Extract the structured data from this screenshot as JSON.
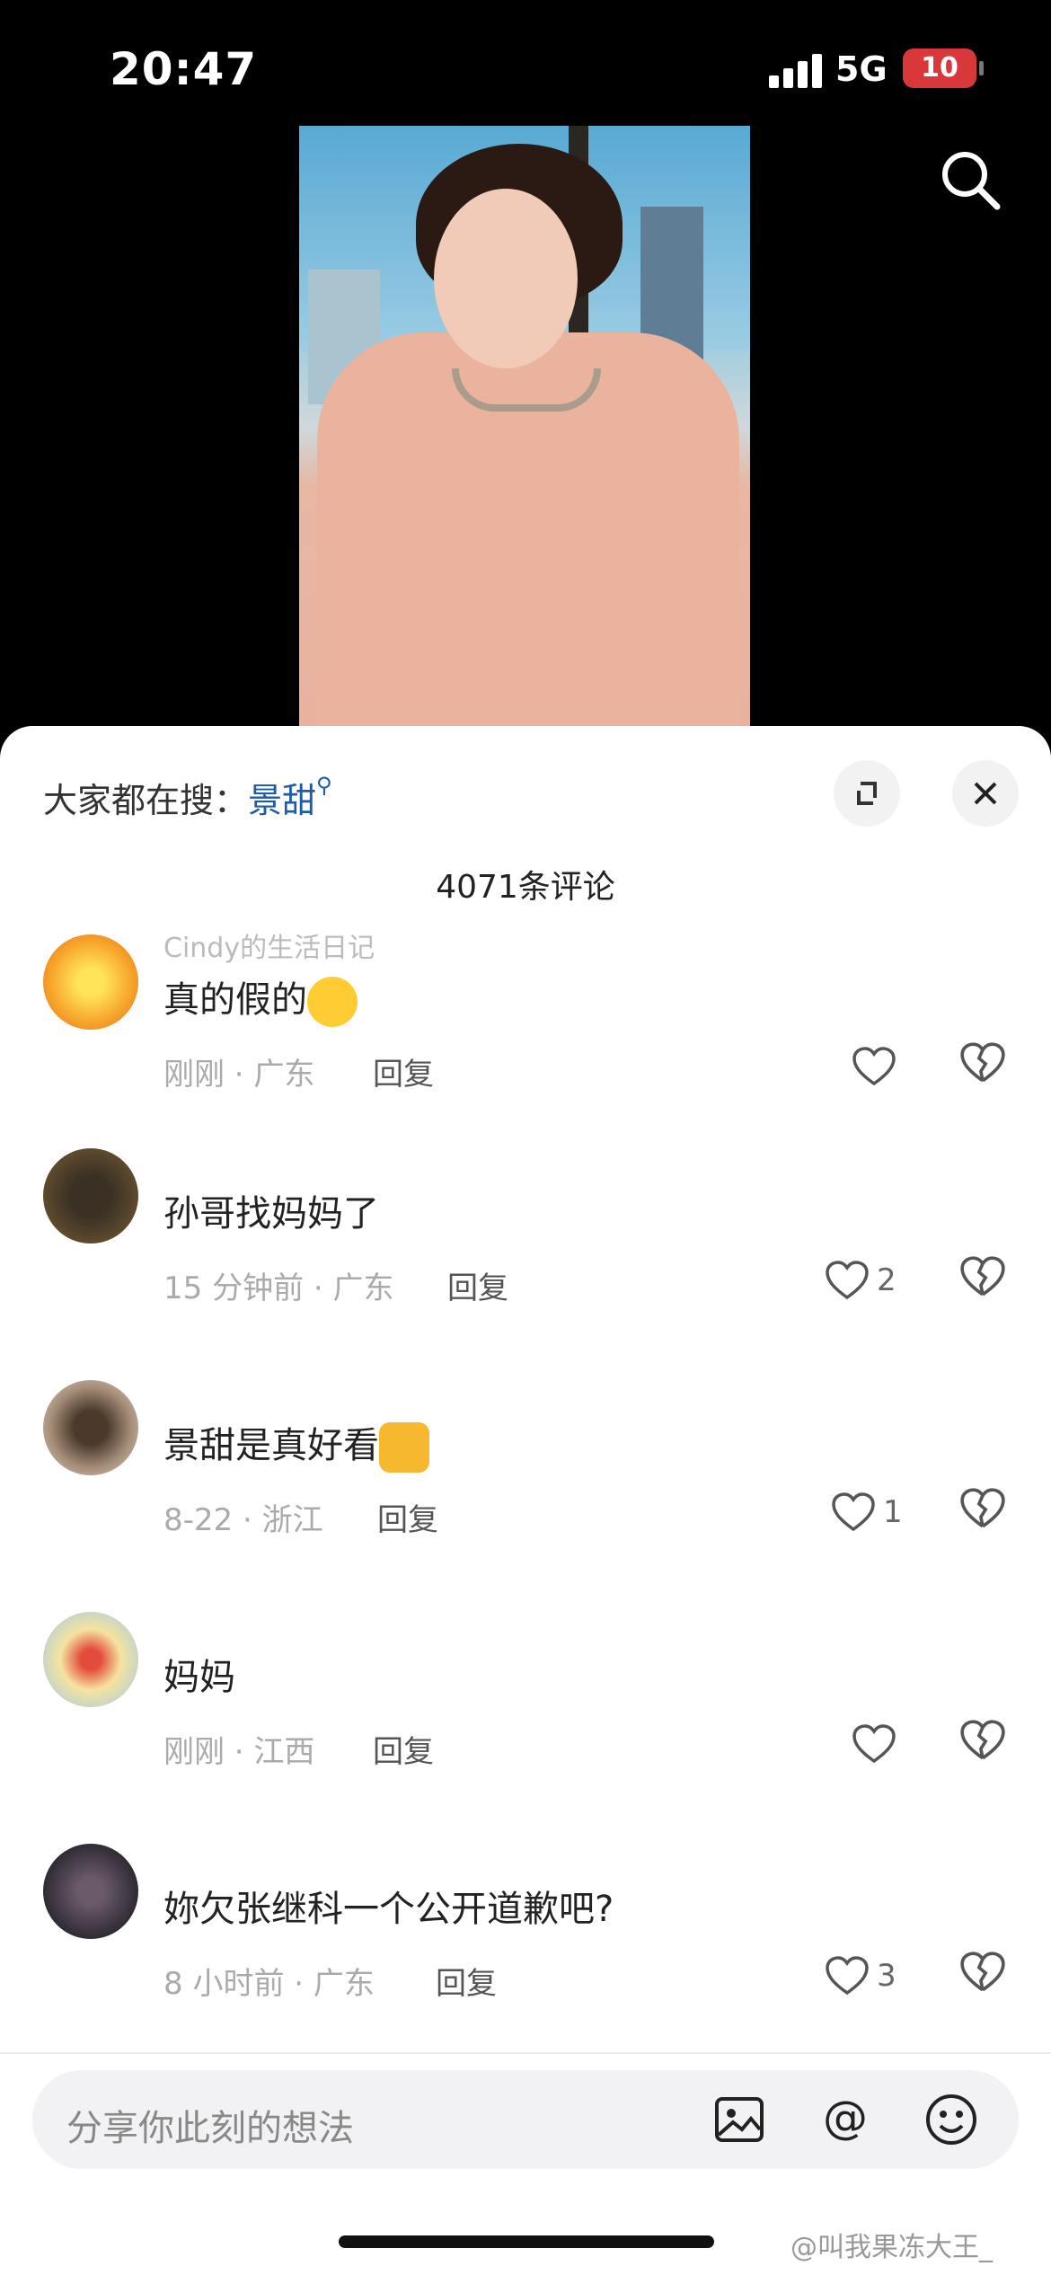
{
  "status": {
    "time": "20:47",
    "network": "5G",
    "battery": "10"
  },
  "trending": {
    "prefix": "大家都在搜：",
    "keyword": "景甜"
  },
  "comment_count": "4071条评论",
  "comments": [
    {
      "name": "Cindy的生活日记",
      "text": "真的假的",
      "meta": "刚刚 · 广东",
      "reply": "回复",
      "likes": ""
    },
    {
      "name": "",
      "text": "孙哥找妈妈了",
      "meta": "15 分钟前 · 广东",
      "reply": "回复",
      "likes": "2"
    },
    {
      "name": "",
      "text": "景甜是真好看",
      "meta": "8-22 · 浙江",
      "reply": "回复",
      "likes": "1"
    },
    {
      "name": "",
      "text": "妈妈",
      "meta": "刚刚 · 江西",
      "reply": "回复",
      "likes": ""
    },
    {
      "name": "",
      "text": "妳欠张继科一个公开道歉吧?",
      "meta": "8 小时前 · 广东",
      "reply": "回复",
      "likes": "3"
    }
  ],
  "input": {
    "placeholder": "分享你此刻的想法"
  },
  "watermark": "@叫我果冻大王_",
  "icons": {
    "search": "search-icon",
    "expand": "expand-icon",
    "close": "close-icon",
    "like": "heart-icon",
    "dislike": "broken-heart-icon",
    "image": "image-icon",
    "mention": "at-icon",
    "emoji": "emoji-icon"
  },
  "colors": {
    "accent": "#1e5aa8",
    "battery_low": "#d9383a"
  }
}
